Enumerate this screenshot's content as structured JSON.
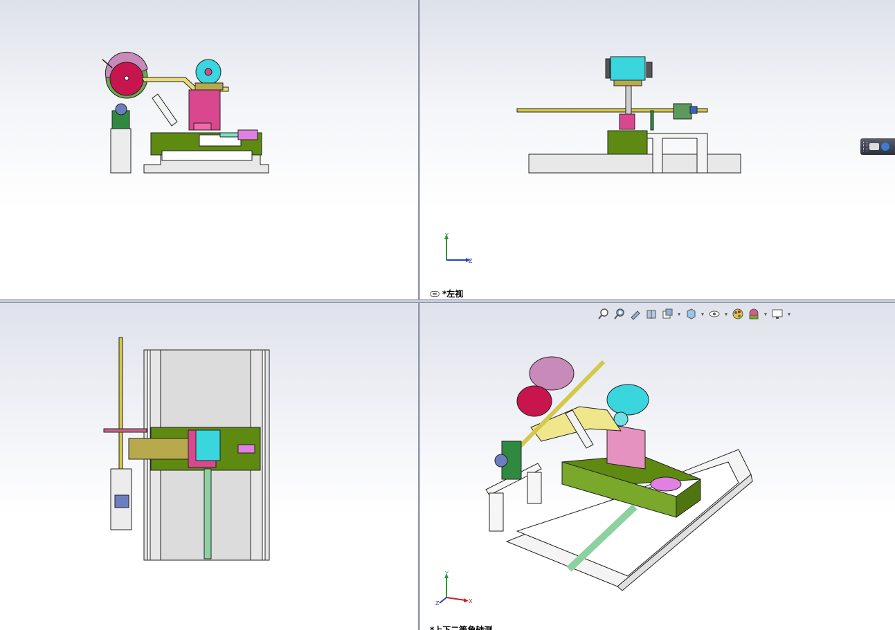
{
  "viewports": {
    "top_left": {
      "label": ""
    },
    "top_right": {
      "label": "*左视"
    },
    "bottom_left": {
      "label": ""
    },
    "bottom_right": {
      "label": "*上下二等角轴测"
    }
  },
  "triad": {
    "x": "X",
    "y": "Y",
    "z": "Z"
  },
  "heads_up_toolbar": {
    "buttons": [
      {
        "name": "zoom-to-fit-icon"
      },
      {
        "name": "zoom-to-area-icon"
      },
      {
        "name": "previous-view-icon"
      },
      {
        "name": "section-view-icon"
      },
      {
        "name": "view-orientation-icon"
      },
      {
        "name": "display-style-icon"
      },
      {
        "name": "hide-show-items-icon"
      },
      {
        "name": "edit-appearance-icon"
      },
      {
        "name": "apply-scene-icon"
      },
      {
        "name": "view-settings-icon"
      }
    ]
  },
  "colors": {
    "viewport_divider": "#c7ccd8",
    "base_green": "#5e8a12",
    "accent_cyan": "#39d6de",
    "accent_magenta": "#d9488f"
  }
}
